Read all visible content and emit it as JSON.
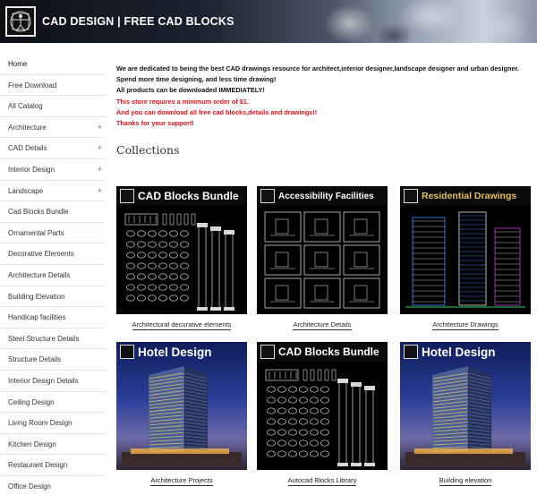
{
  "header": {
    "title": "CAD DESIGN | FREE CAD BLOCKS"
  },
  "sidebar": {
    "items": [
      {
        "label": "Home",
        "expandable": false,
        "active": true
      },
      {
        "label": "Free Download",
        "expandable": false
      },
      {
        "label": "All Catalog",
        "expandable": false
      },
      {
        "label": "Architecture",
        "expandable": true
      },
      {
        "label": "CAD Details",
        "expandable": true
      },
      {
        "label": "Interior Design",
        "expandable": true
      },
      {
        "label": "Landscape",
        "expandable": true
      },
      {
        "label": "Cad Blocks Bundle",
        "expandable": false
      },
      {
        "label": "Ornamental Parts",
        "expandable": false
      },
      {
        "label": "Decorative Elements",
        "expandable": false
      },
      {
        "label": "Architecture Details",
        "expandable": false
      },
      {
        "label": "Building Elevation",
        "expandable": false
      },
      {
        "label": "Handicap facilities",
        "expandable": false
      },
      {
        "label": "Steel Structure Details",
        "expandable": false
      },
      {
        "label": "Structure Details",
        "expandable": false
      },
      {
        "label": "Interior Design Details",
        "expandable": false
      },
      {
        "label": "Ceiling Design",
        "expandable": false
      },
      {
        "label": "Living Room Design",
        "expandable": false
      },
      {
        "label": "Kitchen Design",
        "expandable": false
      },
      {
        "label": "Restaurant Design",
        "expandable": false
      },
      {
        "label": "Office Design",
        "expandable": false
      }
    ],
    "expand_symbol": "+"
  },
  "intro": {
    "line1": "We are dedicated to being the best CAD drawings resource for architect,interior designer,landscape designer and  urban designer.",
    "line2": "Spend more time designing, and less time drawing!",
    "line3": "All products can be downloaded IMMEDIATELY!",
    "line4": "This store requires a minimum order of $1.",
    "line5": "And you can download all free cad blocks,details and drawings!!",
    "line6": "Thanks for your support!"
  },
  "collections": {
    "title": "Collections",
    "tiles": [
      {
        "banner": "CAD Blocks Bundle",
        "caption": "Architectural decorative elements",
        "style": "ornament"
      },
      {
        "banner": "Accessibility Facilities",
        "caption": "Architecture Details",
        "style": "details"
      },
      {
        "banner": "Residential Drawings",
        "caption": "Architecture Drawings",
        "style": "residential"
      },
      {
        "banner": "Hotel Design",
        "caption": "Architecture Projects",
        "style": "hotel"
      },
      {
        "banner": "CAD Blocks Bundle",
        "caption": "Autocad Blocks Library",
        "style": "ornament"
      },
      {
        "banner": "Hotel Design",
        "caption": "Building elevation",
        "style": "hotel"
      }
    ]
  },
  "colors": {
    "accent_red": "#d8151b",
    "banner_gold": "#e4c05a",
    "sidebar_divider": "#e4e4e4"
  },
  "icons": [
    "vitruvian-logo-icon",
    "expand-plus-icon",
    "banner-logo-icon"
  ]
}
